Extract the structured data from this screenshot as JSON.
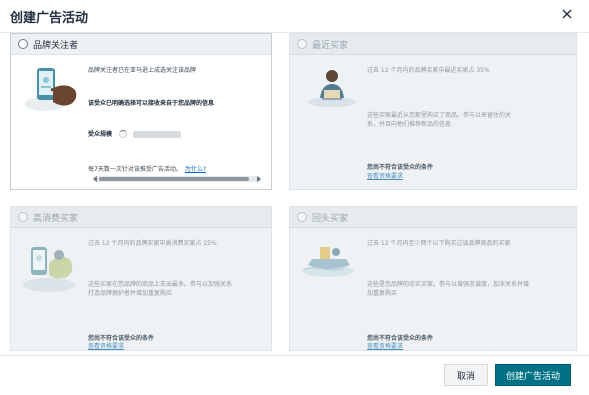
{
  "modal": {
    "title": "创建广告活动"
  },
  "cards": {
    "brand_followers": {
      "title": "品牌关注者",
      "desc": "品牌关注者已在亚马逊上成选关注该品牌",
      "note": "该受众已明确选择可以接收来自于您品牌的信息",
      "audience_label": "受众规模",
      "footer_text": "每7天数一次针对该推受广告活动。",
      "footer_link": "为什么?"
    },
    "recent_buyers": {
      "title": "最近买家",
      "desc": "过去 12 个月内的品牌买家中最近买家占 35%",
      "line1": "这些买家最近从您那里购买了商品。参与以来留住的关",
      "line2": "系，并且向他们推荐新品的信息",
      "warning": "您尚不符合该受众的条件",
      "link": "查看资格要求"
    },
    "repeat_buyers": {
      "title": "高消费买家",
      "desc": "过去 12 个月内的品牌买家中高消费买家占 25%",
      "line1": "这些买家在您品牌的商品上支出最多。参与以加强关系",
      "line2": "打造品牌拥护者并增加重复购买",
      "warning": "您尚不符合该受众的条件",
      "link": "查看资格要求"
    },
    "lapsed_buyers": {
      "title": "回头买家",
      "desc": "过去 12 个月内至少两个以下购买过该品牌商品的买家",
      "line1": "这些是您品牌的忠实买家。参与以增强忠诚度，加深关系并增",
      "line2": "加重复购买",
      "warning": "您尚不符合该受众的条件",
      "link": "查看资格要求"
    }
  },
  "footer": {
    "cancel_label": "取消",
    "create_label": "创建广告活动"
  },
  "icons": {
    "close": "close-icon",
    "brand_follower_illustration": "phone-hand-illustration",
    "recent_buyer_illustration": "person-laptop-illustration",
    "repeat_buyer_illustration": "phone-shopping-illustration",
    "lapsed_buyer_illustration": "boat-illustration"
  },
  "colors": {
    "primary": "#007185",
    "link": "#0066c0",
    "disabled_bg": "#eef2f4"
  }
}
